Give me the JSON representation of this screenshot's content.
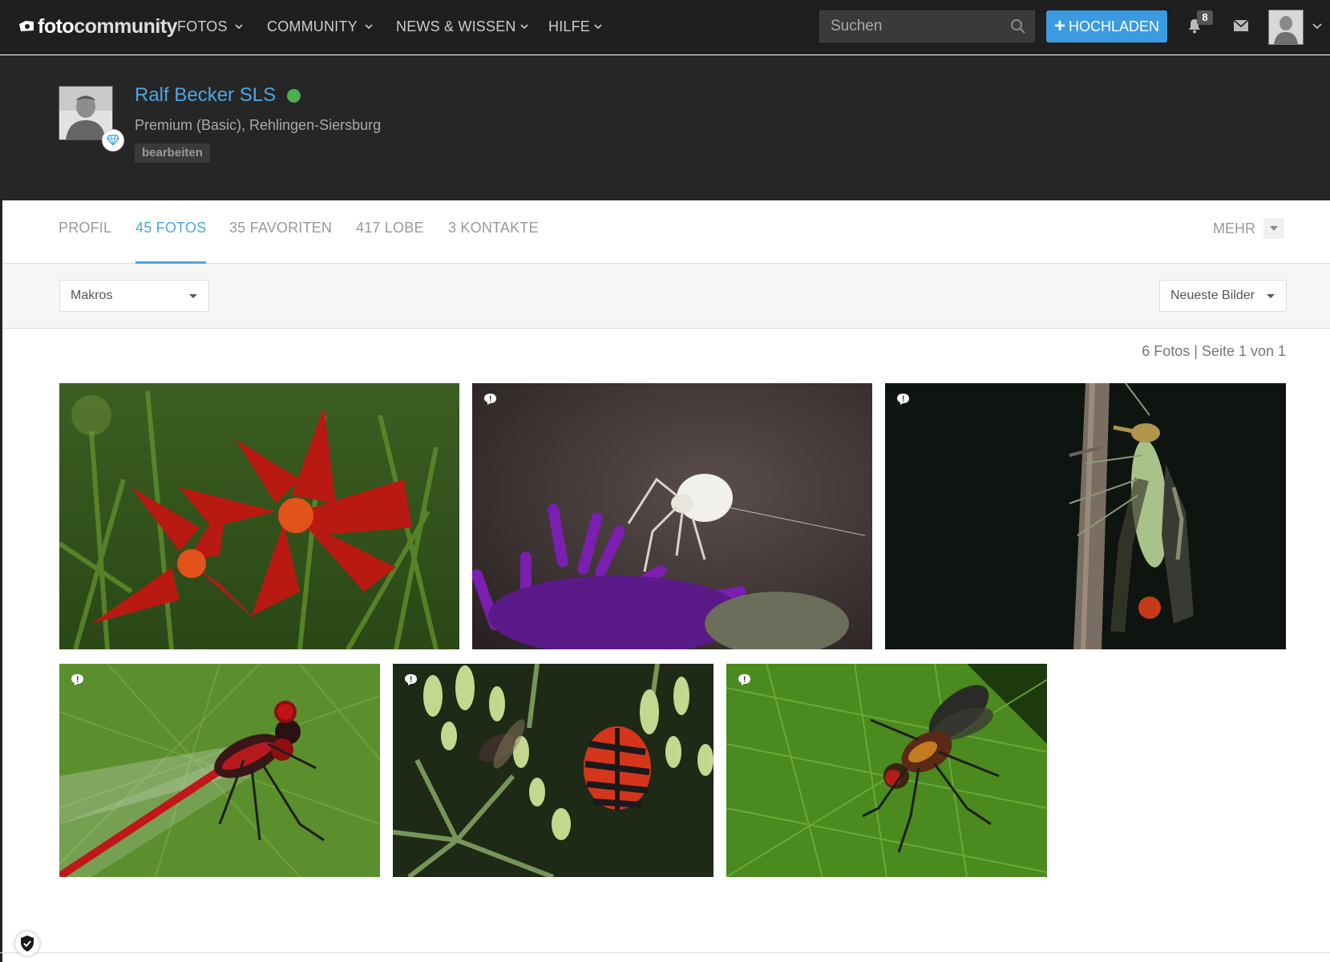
{
  "navbar": {
    "logo_part1": "foto",
    "logo_part2": "community",
    "menu": [
      {
        "label": "FOTOS"
      },
      {
        "label": "COMMUNITY"
      },
      {
        "label": "NEWS & WISSEN"
      },
      {
        "label": "HILFE"
      }
    ],
    "search_placeholder": "Suchen",
    "upload_label": "HOCHLADEN",
    "notifications_count": "8"
  },
  "profile": {
    "name": "Ralf Becker SLS",
    "subtitle": "Premium (Basic), Rehlingen-Siersburg",
    "edit_label": "bearbeiten",
    "status_color": "#4caf50"
  },
  "tabs": [
    {
      "label": "PROFIL"
    },
    {
      "label": "45 FOTOS",
      "active": true
    },
    {
      "label": "35 FAVORITEN"
    },
    {
      "label": "417 LOBE"
    },
    {
      "label": "3 KONTAKTE"
    }
  ],
  "more_label": "MEHR",
  "filters": {
    "album": "Makros",
    "sort": "Neueste Bilder"
  },
  "gallery": {
    "count_text": "6 Fotos | Seite 1 von 1",
    "photos": [
      {
        "subject": "red-lily",
        "has_comment": false
      },
      {
        "subject": "white-crab-spider",
        "has_comment": true
      },
      {
        "subject": "scorpionfly",
        "has_comment": true
      },
      {
        "subject": "red-damselfly",
        "has_comment": true
      },
      {
        "subject": "striped-shield-bug",
        "has_comment": true
      },
      {
        "subject": "fly-on-leaf",
        "has_comment": true
      }
    ]
  },
  "colors": {
    "accent": "#4da6e5",
    "upload": "#3b9ae0",
    "navbar": "#1f1f1f",
    "profile_bg": "#262626"
  }
}
